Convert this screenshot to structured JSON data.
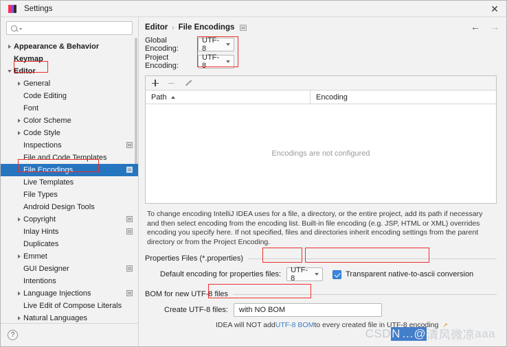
{
  "window": {
    "title": "Settings",
    "close_label": "✕",
    "app_icon": "intellij-idea-icon"
  },
  "sidebar": {
    "search": {
      "value": "",
      "placeholder": ""
    },
    "items": [
      {
        "label": "Appearance & Behavior",
        "depth": 0,
        "twisty": "right",
        "bold": true,
        "selected": false,
        "badge": false
      },
      {
        "label": "Keymap",
        "depth": 0,
        "twisty": "none",
        "bold": true,
        "selected": false,
        "badge": false
      },
      {
        "label": "Editor",
        "depth": 0,
        "twisty": "down",
        "bold": true,
        "selected": false,
        "badge": false
      },
      {
        "label": "General",
        "depth": 1,
        "twisty": "right",
        "bold": false,
        "selected": false,
        "badge": false
      },
      {
        "label": "Code Editing",
        "depth": 1,
        "twisty": "none",
        "bold": false,
        "selected": false,
        "badge": false
      },
      {
        "label": "Font",
        "depth": 1,
        "twisty": "none",
        "bold": false,
        "selected": false,
        "badge": false
      },
      {
        "label": "Color Scheme",
        "depth": 1,
        "twisty": "right",
        "bold": false,
        "selected": false,
        "badge": false
      },
      {
        "label": "Code Style",
        "depth": 1,
        "twisty": "right",
        "bold": false,
        "selected": false,
        "badge": false
      },
      {
        "label": "Inspections",
        "depth": 1,
        "twisty": "none",
        "bold": false,
        "selected": false,
        "badge": true
      },
      {
        "label": "File and Code Templates",
        "depth": 1,
        "twisty": "none",
        "bold": false,
        "selected": false,
        "badge": false
      },
      {
        "label": "File Encodings",
        "depth": 1,
        "twisty": "none",
        "bold": false,
        "selected": true,
        "badge": true
      },
      {
        "label": "Live Templates",
        "depth": 1,
        "twisty": "none",
        "bold": false,
        "selected": false,
        "badge": false
      },
      {
        "label": "File Types",
        "depth": 1,
        "twisty": "none",
        "bold": false,
        "selected": false,
        "badge": false
      },
      {
        "label": "Android Design Tools",
        "depth": 1,
        "twisty": "none",
        "bold": false,
        "selected": false,
        "badge": false
      },
      {
        "label": "Copyright",
        "depth": 1,
        "twisty": "right",
        "bold": false,
        "selected": false,
        "badge": true
      },
      {
        "label": "Inlay Hints",
        "depth": 1,
        "twisty": "none",
        "bold": false,
        "selected": false,
        "badge": true
      },
      {
        "label": "Duplicates",
        "depth": 1,
        "twisty": "none",
        "bold": false,
        "selected": false,
        "badge": false
      },
      {
        "label": "Emmet",
        "depth": 1,
        "twisty": "right",
        "bold": false,
        "selected": false,
        "badge": false
      },
      {
        "label": "GUI Designer",
        "depth": 1,
        "twisty": "none",
        "bold": false,
        "selected": false,
        "badge": true
      },
      {
        "label": "Intentions",
        "depth": 1,
        "twisty": "none",
        "bold": false,
        "selected": false,
        "badge": false
      },
      {
        "label": "Language Injections",
        "depth": 1,
        "twisty": "right",
        "bold": false,
        "selected": false,
        "badge": true
      },
      {
        "label": "Live Edit of Compose Literals",
        "depth": 1,
        "twisty": "none",
        "bold": false,
        "selected": false,
        "badge": false
      },
      {
        "label": "Natural Languages",
        "depth": 1,
        "twisty": "right",
        "bold": false,
        "selected": false,
        "badge": false
      }
    ],
    "help_label": "?"
  },
  "breadcrumb": {
    "parent": "Editor",
    "separator": "›",
    "current": "File Encodings"
  },
  "nav": {
    "back": "←",
    "forward": "→"
  },
  "encoding": {
    "global_label": "Global Encoding:",
    "global_value": "UTF-8",
    "project_label": "Project Encoding:",
    "project_value": "UTF-8"
  },
  "table": {
    "toolbar": {
      "add": "add-icon",
      "remove": "remove-icon",
      "edit": "edit-icon"
    },
    "columns": [
      "Path",
      "Encoding"
    ],
    "rows": [],
    "empty_text": "Encodings are not configured"
  },
  "description": "To change encoding IntelliJ IDEA uses for a file, a directory, or the entire project, add its path if necessary and then select encoding from the encoding list. Built-in file encoding (e.g. JSP, HTML or XML) overrides encoding you specify here. If not specified, files and directories inherit encoding settings from the parent directory or from the Project Encoding.",
  "properties_group": {
    "title": "Properties Files (*.properties)",
    "field_label": "Default encoding for properties files:",
    "field_value": "UTF-8",
    "checkbox_label": "Transparent native-to-ascii conversion",
    "checkbox_checked": true
  },
  "bom_group": {
    "title": "BOM for new UTF-8 files",
    "field_label": "Create UTF-8 files:",
    "field_value": "with NO BOM",
    "hint_prefix": "IDEA will NOT add ",
    "hint_link": "UTF-8 BOM",
    "hint_suffix": " to every created file in UTF-8 encoding",
    "hint_external_icon": "↗"
  },
  "watermark": {
    "prefix": "CSD",
    "selected": "N",
    "mid": "…@",
    "chinese": "清风微凉",
    "suffix": "aaa"
  },
  "colors": {
    "accent_selection": "#2675bf",
    "annotation_red": "#ef2d2d",
    "link_blue": "#3b7dc4",
    "checkbox_blue": "#3b87df"
  }
}
